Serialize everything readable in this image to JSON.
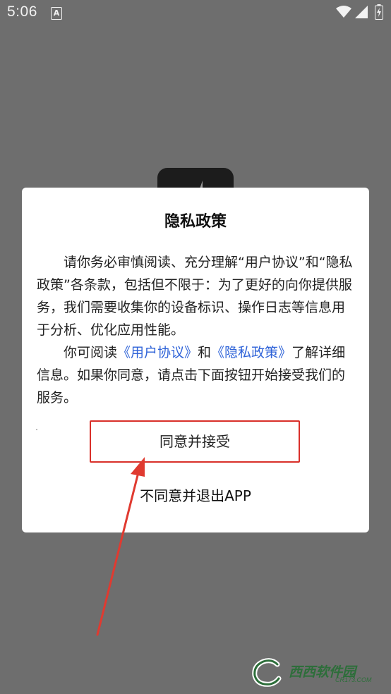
{
  "status_bar": {
    "time": "5:06",
    "notification_icon": "A",
    "icons": [
      "wifi-icon",
      "signal-icon",
      "battery-charging-icon"
    ]
  },
  "dialog": {
    "title": "隐私政策",
    "paragraph1": "请你务必审慎阅读、充分理解“用户协议”和“隐私政策”各条款，包括但不限于：为了更好的向你提供服务，我们需要收集你的设备标识、操作日志等信息用于分析、优化应用性能。",
    "paragraph2_prefix": "你可阅读",
    "user_agreement_link": "《用户协议》",
    "paragraph2_and": "和",
    "privacy_policy_link": "《隐私政策》",
    "paragraph2_suffix": "了解详细信息。如果你同意，请点击下面按钮开始接受我们的服务。",
    "agree_button": "同意并接受",
    "decline_button": "不同意并退出APP"
  },
  "annotation": {
    "highlight_color": "#d9302a",
    "arrow_color": "#e03a30"
  },
  "watermark": {
    "text": "西西软件园",
    "subtext": "CR173.COM"
  }
}
